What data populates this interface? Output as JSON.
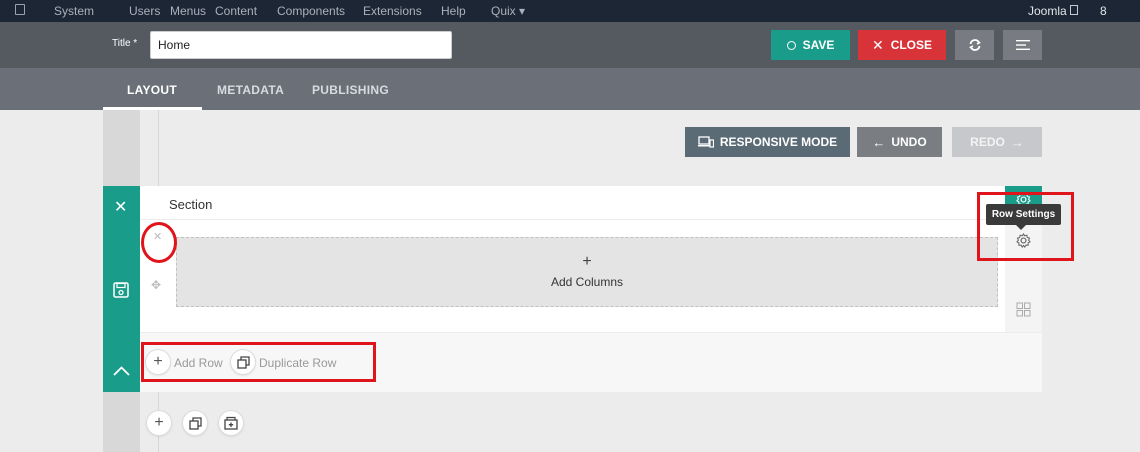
{
  "topnav": {
    "items": [
      "System",
      "Users",
      "Menus",
      "Content",
      "Components",
      "Extensions",
      "Help",
      "Quix ▾"
    ],
    "site_name": "Joomla",
    "user_count": "8"
  },
  "toolbar": {
    "title_label": "Title *",
    "title_value": "Home",
    "save_label": "SAVE",
    "close_label": "CLOSE"
  },
  "tabs": [
    "LAYOUT",
    "METADATA",
    "PUBLISHING"
  ],
  "builder": {
    "responsive_label": "RESPONSIVE MODE",
    "undo_label": "UNDO",
    "redo_label": "REDO",
    "section_title": "Section",
    "add_columns_plus": "+",
    "add_columns_label": "Add Columns",
    "row_settings_tooltip": "Row Settings",
    "add_row_label": "Add Row",
    "duplicate_row_label": "Duplicate Row"
  },
  "colors": {
    "teal": "#1a9c8a",
    "red": "#d9333a",
    "annotation": "#e0141b"
  }
}
